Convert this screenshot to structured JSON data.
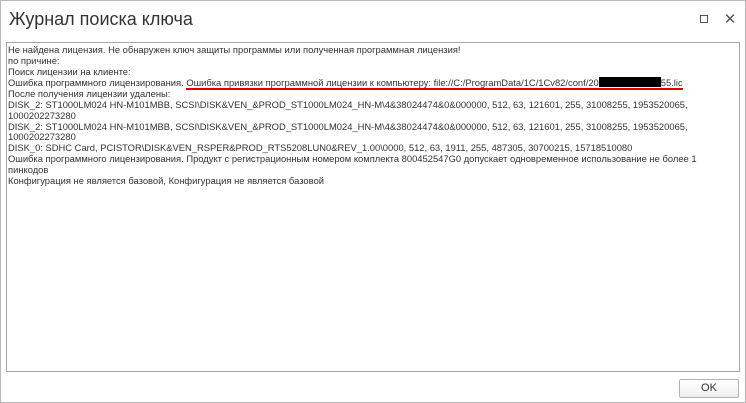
{
  "window": {
    "title": "Журнал поиска ключа"
  },
  "controls": {
    "maximize_icon": "maximize-icon",
    "close_icon": "close-icon"
  },
  "log": {
    "line1": "Не найдена лицензия. Не обнаружен ключ защиты программы или полученная программная лицензия!",
    "line2": "по причине:",
    "line3": "Поиск лицензии на клиенте:",
    "line4_prefix": "Ошибка программного лицензирования. ",
    "line4_highlight_start": "Ошибка привязки программной лицензии к компьютеру: file://C:/ProgramData/1C/1Cv82/conf/20",
    "line4_highlight_end": "55.lic",
    "line5": "После получения лицензии удалены:",
    "line6": "DISK_2: ST1000LM024 HN-M101MBB, SCSI\\DISK&VEN_&PROD_ST1000LM024_HN-M\\4&38024474&0&000000, 512, 63, 121601, 255, 31008255, 1953520065, 1000202273280",
    "line7": "DISK_2: ST1000LM024 HN-M101MBB, SCSI\\DISK&VEN_&PROD_ST1000LM024_HN-M\\4&38024474&0&000000, 512, 63, 121601, 255, 31008255, 1953520065, 1000202273280",
    "line8": "DISK_0: SDHC Card, PCISTOR\\DISK&VEN_RSPER&PROD_RTS5208LUN0&REV_1.00\\0000, 512, 63, 1911, 255, 487305, 30700215, 15718510080",
    "line9": "Ошибка программного лицензирования. Продукт с регистрационным номером комплекта 800452547G0 допускает одновременное использование не более 1 пинкодов",
    "line10": "Конфигурация не является базовой, Конфигурация не является базовой"
  },
  "buttons": {
    "ok_label": "OK"
  },
  "colors": {
    "highlight_underline": "#e00000",
    "text": "#333333",
    "redaction": "#000000"
  }
}
